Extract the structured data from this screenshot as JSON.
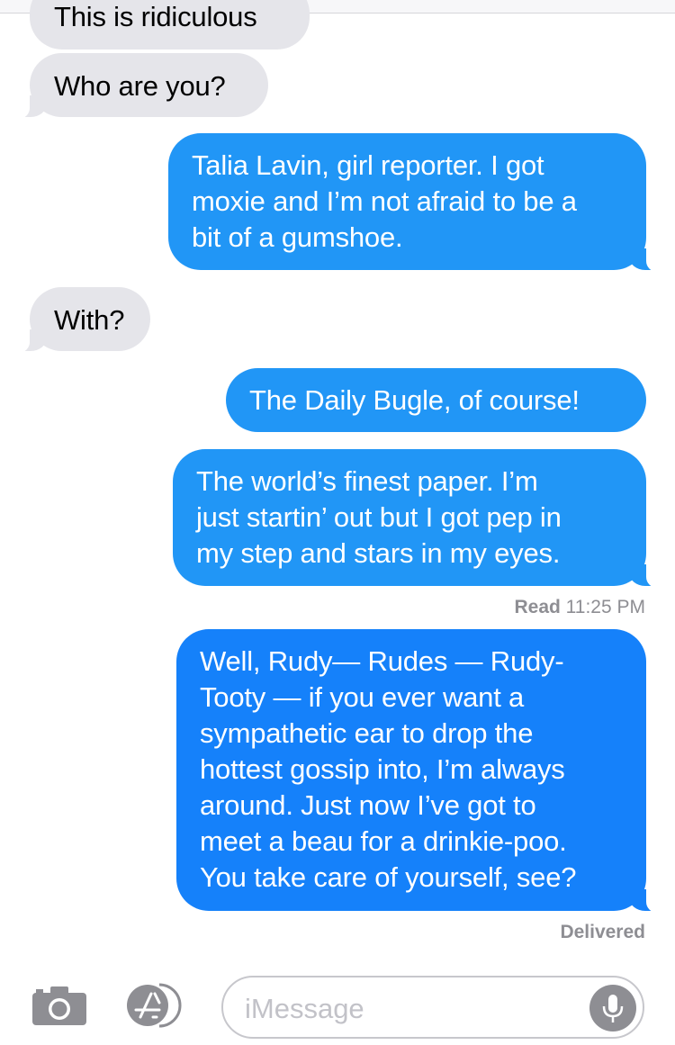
{
  "messages": [
    {
      "direction": "incoming",
      "text": "This is ridiculous"
    },
    {
      "direction": "incoming",
      "text": "Who are you?"
    },
    {
      "direction": "outgoing",
      "lines": [
        "Talia Lavin, girl reporter. I got",
        "moxie and I’m not afraid to be a",
        "bit of a gumshoe."
      ]
    },
    {
      "direction": "incoming",
      "text": "With?"
    },
    {
      "direction": "outgoing",
      "text": "The Daily Bugle, of course!"
    },
    {
      "direction": "outgoing",
      "lines": [
        "The world’s finest paper. I’m",
        "just startin’ out but I got pep in",
        "my step and stars in my eyes."
      ]
    },
    {
      "direction": "outgoing",
      "lines": [
        "Well, Rudy— Rudes — Rudy-",
        "Tooty — if you ever want a",
        "sympathetic ear to drop the",
        "hottest gossip into, I’m always",
        "around. Just now I’ve got to",
        "meet a beau for a drinkie-poo.",
        "You take care of yourself, see?"
      ]
    }
  ],
  "read_receipt": {
    "label": "Read",
    "time": "11:25 PM"
  },
  "delivered_label": "Delivered",
  "input_bar": {
    "placeholder": "iMessage",
    "icons": [
      "camera-icon",
      "app-store-icon",
      "microphone-icon"
    ]
  },
  "colors": {
    "incoming_bubble": "#e5e5ea",
    "outgoing_bubble": "#2196f6",
    "outgoing_bubble_latest": "#1581fa",
    "icon_gray": "#8e8e93"
  }
}
